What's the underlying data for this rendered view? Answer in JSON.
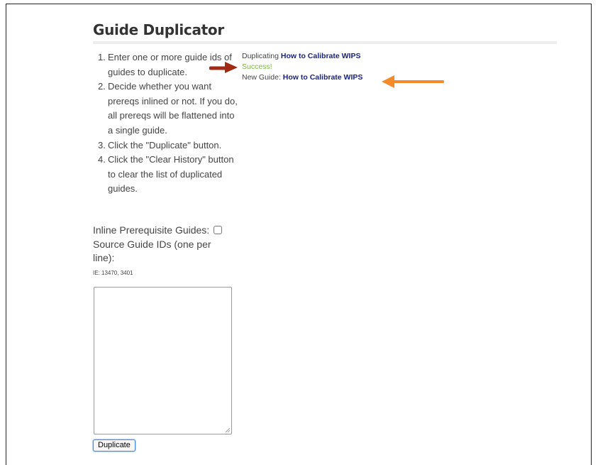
{
  "page": {
    "title": "Guide Duplicator"
  },
  "instructions": [
    {
      "num": "1.",
      "text": "Enter one or more guide ids of guides to duplicate."
    },
    {
      "num": "2.",
      "text": "Decide whether you want prereqs inlined or not. If you do, all prereqs will be flattened into a single guide."
    },
    {
      "num": "3.",
      "text": "Click the \"Duplicate\" button."
    },
    {
      "num": "4.",
      "text": "Click the \"Clear History\" button to clear the list of duplicated guides."
    }
  ],
  "form": {
    "inline_label": "Inline Prerequisite Guides:",
    "inline_checked": false,
    "source_label": "Source Guide IDs (one per line):",
    "example": "IE: 13470, 3401",
    "textarea_value": "",
    "duplicate_label": "Duplicate"
  },
  "log": {
    "duplicating_prefix": "Duplicating",
    "duplicating_guide": "How to Calibrate WIPS",
    "success": "Success!",
    "new_guide_prefix": "New Guide:",
    "new_guide": "How to Calibrate WIPS"
  },
  "annotations": {
    "red_arrow_color": "#a02a14",
    "orange_arrow_color": "#f58a2a"
  }
}
